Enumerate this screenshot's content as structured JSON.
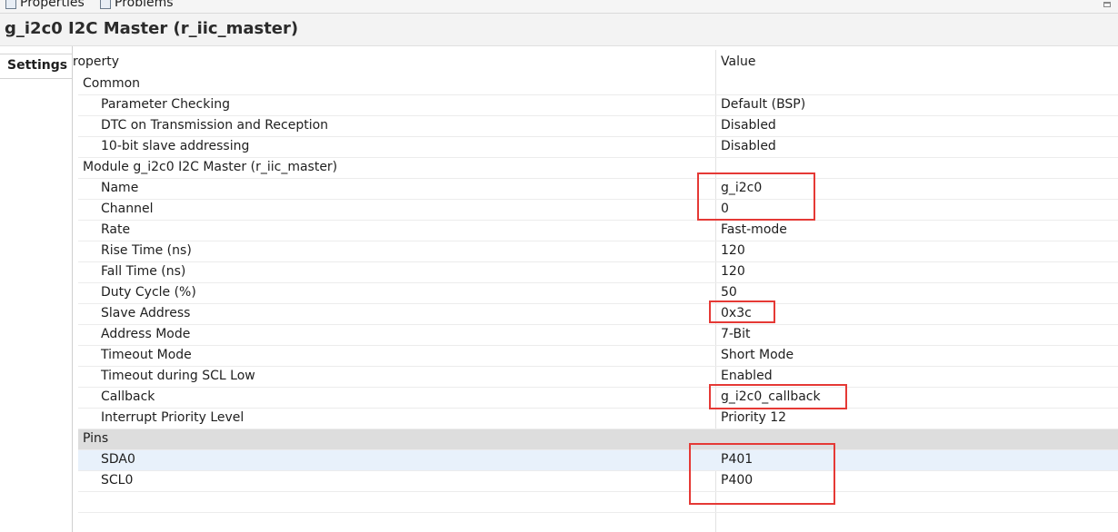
{
  "topbar": {
    "properties_tab": "Properties",
    "problems_tab": "Problems"
  },
  "title": "g_i2c0 I2C Master (r_iic_master)",
  "sidetabs": {
    "settings": "Settings"
  },
  "columns": {
    "property": "roperty",
    "value": "Value"
  },
  "rows": [
    {
      "label": "Common",
      "value": "",
      "level": 0
    },
    {
      "label": "Parameter Checking",
      "value": "Default (BSP)",
      "level": 1
    },
    {
      "label": "DTC on Transmission and Reception",
      "value": "Disabled",
      "level": 1
    },
    {
      "label": "10-bit slave addressing",
      "value": "Disabled",
      "level": 1
    },
    {
      "label": "Module g_i2c0 I2C Master (r_iic_master)",
      "value": "",
      "level": 0
    },
    {
      "label": "Name",
      "value": "g_i2c0",
      "level": 1
    },
    {
      "label": "Channel",
      "value": "0",
      "level": 1
    },
    {
      "label": "Rate",
      "value": "Fast-mode",
      "level": 1
    },
    {
      "label": "Rise Time (ns)",
      "value": "120",
      "level": 1
    },
    {
      "label": "Fall Time (ns)",
      "value": "120",
      "level": 1
    },
    {
      "label": "Duty Cycle (%)",
      "value": "50",
      "level": 1
    },
    {
      "label": "Slave Address",
      "value": "0x3c",
      "level": 1
    },
    {
      "label": "Address Mode",
      "value": "7-Bit",
      "level": 1
    },
    {
      "label": "Timeout Mode",
      "value": "Short Mode",
      "level": 1
    },
    {
      "label": "Timeout during SCL Low",
      "value": "Enabled",
      "level": 1
    },
    {
      "label": "Callback",
      "value": "g_i2c0_callback",
      "level": 1
    },
    {
      "label": "Interrupt Priority Level",
      "value": "Priority 12",
      "level": 1
    },
    {
      "label": "Pins",
      "value": "",
      "level": 0
    },
    {
      "label": "SDA0",
      "value": "P401",
      "level": 1
    },
    {
      "label": "SCL0",
      "value": "P400",
      "level": 1
    }
  ],
  "colors": {
    "highlight": "#e53935",
    "selected_row": "#e8f1fb",
    "group_row": "#dddddd"
  },
  "icons": {
    "properties_tab": "properties-icon",
    "problems_tab": "problems-icon",
    "maximize": "maximize-icon"
  }
}
